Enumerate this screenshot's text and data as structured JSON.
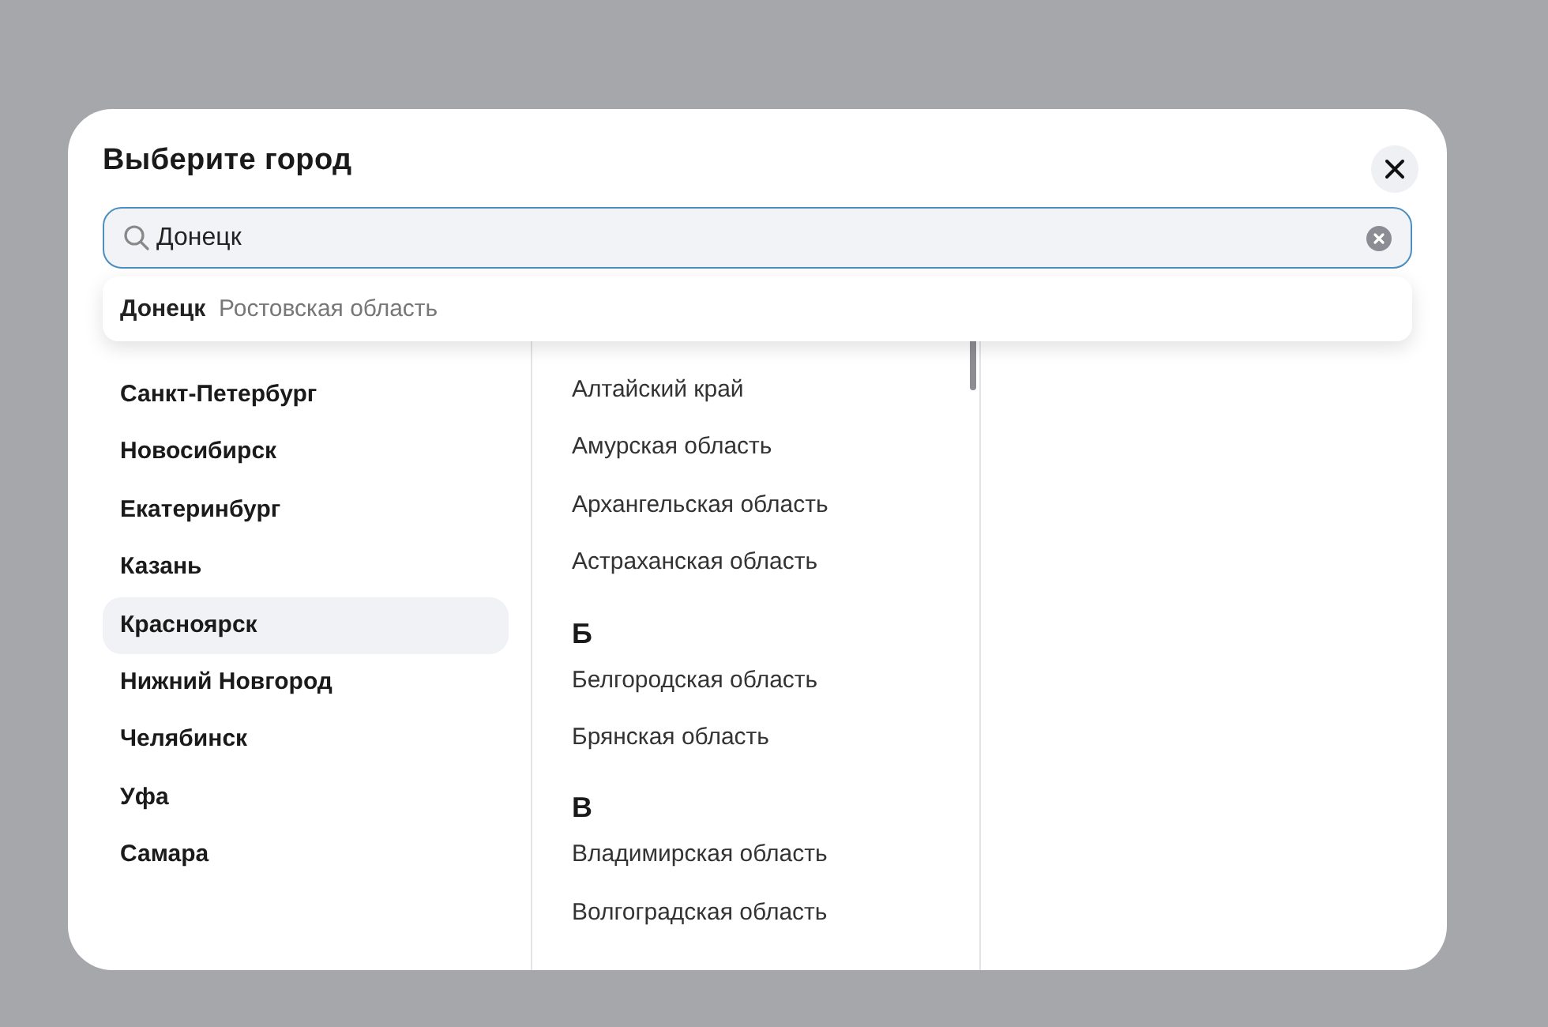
{
  "dialog": {
    "title": "Выберите город"
  },
  "search": {
    "value": "Донецк"
  },
  "suggestions": [
    {
      "city": "Донецк",
      "region": "Ростовская область"
    }
  ],
  "cities": [
    {
      "name": "Санкт-Петербург",
      "selected": false
    },
    {
      "name": "Новосибирск",
      "selected": false
    },
    {
      "name": "Екатеринбург",
      "selected": false
    },
    {
      "name": "Казань",
      "selected": false
    },
    {
      "name": "Красноярск",
      "selected": true
    },
    {
      "name": "Нижний Новгород",
      "selected": false
    },
    {
      "name": "Челябинск",
      "selected": false
    },
    {
      "name": "Уфа",
      "selected": false
    },
    {
      "name": "Самара",
      "selected": false
    }
  ],
  "regions": [
    {
      "kind": "item",
      "text": "Алтайский край"
    },
    {
      "kind": "item",
      "text": "Амурская область"
    },
    {
      "kind": "item",
      "text": "Архангельская область"
    },
    {
      "kind": "item",
      "text": "Астраханская область"
    },
    {
      "kind": "letter",
      "text": "Б"
    },
    {
      "kind": "item",
      "text": "Белгородская область"
    },
    {
      "kind": "item",
      "text": "Брянская область"
    },
    {
      "kind": "letter",
      "text": "В"
    },
    {
      "kind": "item",
      "text": "Владимирская область"
    },
    {
      "kind": "item",
      "text": "Волгоградская область"
    }
  ]
}
